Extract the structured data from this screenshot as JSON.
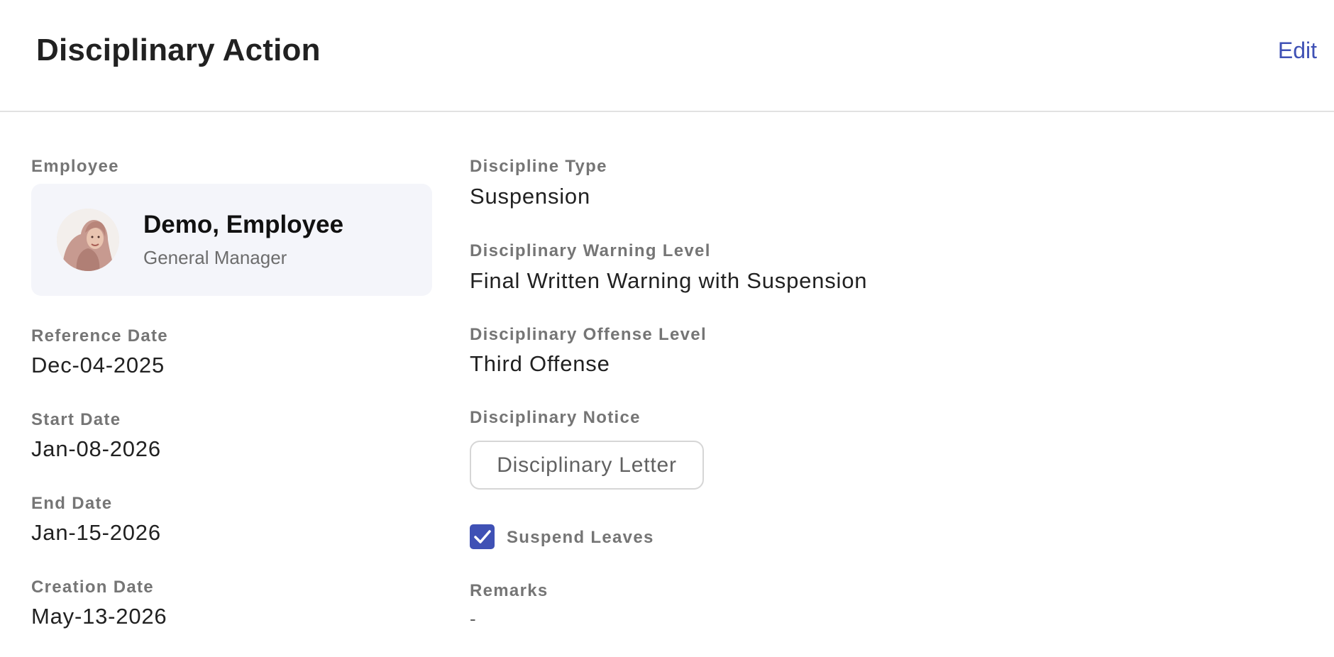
{
  "header": {
    "title": "Disciplinary Action",
    "edit_label": "Edit"
  },
  "colors": {
    "accent": "#3f51b5",
    "card_bg": "#f4f5fa",
    "label_gray": "#757575"
  },
  "employee": {
    "label": "Employee",
    "name": "Demo, Employee",
    "role": "General Manager",
    "avatar_icon": "avatar-photo"
  },
  "left_fields": {
    "reference_date": {
      "label": "Reference Date",
      "value": "Dec-04-2025"
    },
    "start_date": {
      "label": "Start Date",
      "value": "Jan-08-2026"
    },
    "end_date": {
      "label": "End Date",
      "value": "Jan-15-2026"
    },
    "creation_date": {
      "label": "Creation Date",
      "value": "May-13-2026"
    }
  },
  "right_fields": {
    "discipline_type": {
      "label": "Discipline Type",
      "value": "Suspension"
    },
    "warning_level": {
      "label": "Disciplinary Warning Level",
      "value": "Final Written Warning with Suspension"
    },
    "offense_level": {
      "label": "Disciplinary Offense Level",
      "value": "Third Offense"
    },
    "notice": {
      "label": "Disciplinary Notice",
      "button_label": "Disciplinary Letter"
    },
    "suspend_leaves": {
      "label": "Suspend Leaves",
      "checked": true,
      "icon": "checkmark-icon"
    },
    "remarks": {
      "label": "Remarks",
      "value": "-"
    }
  }
}
